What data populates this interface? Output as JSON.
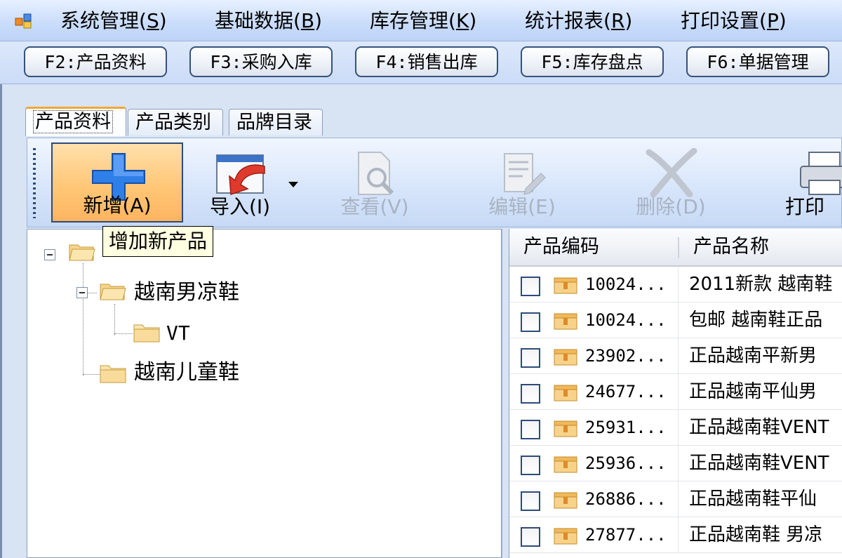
{
  "menu": {
    "items": [
      {
        "text": "系统管理",
        "key": "S"
      },
      {
        "text": "基础数据",
        "key": "B"
      },
      {
        "text": "库存管理",
        "key": "K"
      },
      {
        "text": "统计报表",
        "key": "R"
      },
      {
        "text": "打印设置",
        "key": "P"
      }
    ]
  },
  "fkeys": [
    {
      "label": "F2:产品资料"
    },
    {
      "label": "F3:采购入库"
    },
    {
      "label": "F4:销售出库"
    },
    {
      "label": "F5:库存盘点"
    },
    {
      "label": "F6:单据管理"
    }
  ],
  "tabs": [
    {
      "label": "产品资料"
    },
    {
      "label": "产品类别"
    },
    {
      "label": "品牌目录"
    }
  ],
  "toolbar": {
    "add": "新增(A)",
    "import": "导入(I)",
    "view": "查看(V)",
    "edit": "编辑(E)",
    "delete": "删除(D)",
    "print": "打印"
  },
  "tooltip": "增加新产品",
  "tree": {
    "nodes": [
      {
        "label": "越南男凉鞋"
      },
      {
        "label": "VT"
      },
      {
        "label": "越南儿童鞋"
      }
    ]
  },
  "grid": {
    "columns": [
      "产品编码",
      "产品名称"
    ],
    "rows": [
      {
        "code": "10024...",
        "name": "2011新款 越南鞋"
      },
      {
        "code": "10024...",
        "name": "包邮 越南鞋正品"
      },
      {
        "code": "23902...",
        "name": "正品越南平新男"
      },
      {
        "code": "24677...",
        "name": "正品越南平仙男"
      },
      {
        "code": "25931...",
        "name": "正品越南鞋VENT"
      },
      {
        "code": "25936...",
        "name": "正品越南鞋VENT"
      },
      {
        "code": "26886...",
        "name": "正品越南鞋平仙"
      },
      {
        "code": "27877...",
        "name": "正品越南鞋 男凉"
      }
    ]
  },
  "colors": {
    "menubar": "#c9dcfb",
    "tooltip_bg": "#ffffe1",
    "hot_button": "#ffc777",
    "add_icon": "#2f7fe8",
    "import_arrow": "#e03a2c"
  }
}
